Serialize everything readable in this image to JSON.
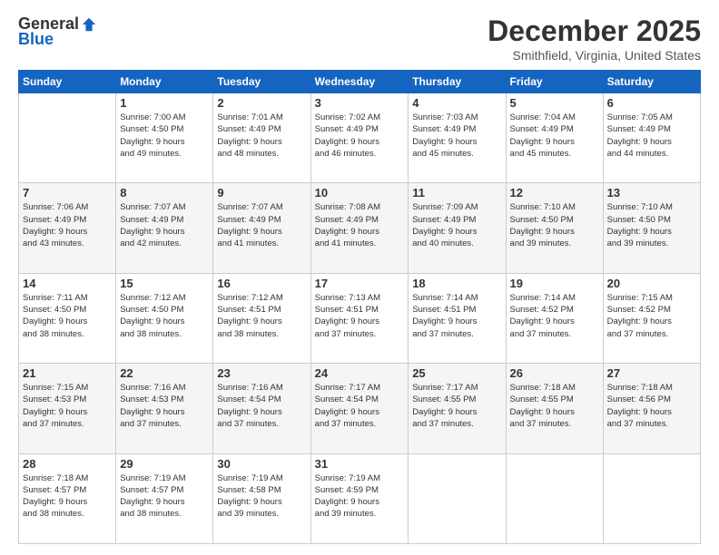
{
  "logo": {
    "general": "General",
    "blue": "Blue"
  },
  "header": {
    "title": "December 2025",
    "location": "Smithfield, Virginia, United States"
  },
  "weekdays": [
    "Sunday",
    "Monday",
    "Tuesday",
    "Wednesday",
    "Thursday",
    "Friday",
    "Saturday"
  ],
  "weeks": [
    [
      {
        "day": "",
        "info": ""
      },
      {
        "day": "1",
        "info": "Sunrise: 7:00 AM\nSunset: 4:50 PM\nDaylight: 9 hours\nand 49 minutes."
      },
      {
        "day": "2",
        "info": "Sunrise: 7:01 AM\nSunset: 4:49 PM\nDaylight: 9 hours\nand 48 minutes."
      },
      {
        "day": "3",
        "info": "Sunrise: 7:02 AM\nSunset: 4:49 PM\nDaylight: 9 hours\nand 46 minutes."
      },
      {
        "day": "4",
        "info": "Sunrise: 7:03 AM\nSunset: 4:49 PM\nDaylight: 9 hours\nand 45 minutes."
      },
      {
        "day": "5",
        "info": "Sunrise: 7:04 AM\nSunset: 4:49 PM\nDaylight: 9 hours\nand 45 minutes."
      },
      {
        "day": "6",
        "info": "Sunrise: 7:05 AM\nSunset: 4:49 PM\nDaylight: 9 hours\nand 44 minutes."
      }
    ],
    [
      {
        "day": "7",
        "info": "Sunrise: 7:06 AM\nSunset: 4:49 PM\nDaylight: 9 hours\nand 43 minutes."
      },
      {
        "day": "8",
        "info": "Sunrise: 7:07 AM\nSunset: 4:49 PM\nDaylight: 9 hours\nand 42 minutes."
      },
      {
        "day": "9",
        "info": "Sunrise: 7:07 AM\nSunset: 4:49 PM\nDaylight: 9 hours\nand 41 minutes."
      },
      {
        "day": "10",
        "info": "Sunrise: 7:08 AM\nSunset: 4:49 PM\nDaylight: 9 hours\nand 41 minutes."
      },
      {
        "day": "11",
        "info": "Sunrise: 7:09 AM\nSunset: 4:49 PM\nDaylight: 9 hours\nand 40 minutes."
      },
      {
        "day": "12",
        "info": "Sunrise: 7:10 AM\nSunset: 4:50 PM\nDaylight: 9 hours\nand 39 minutes."
      },
      {
        "day": "13",
        "info": "Sunrise: 7:10 AM\nSunset: 4:50 PM\nDaylight: 9 hours\nand 39 minutes."
      }
    ],
    [
      {
        "day": "14",
        "info": "Sunrise: 7:11 AM\nSunset: 4:50 PM\nDaylight: 9 hours\nand 38 minutes."
      },
      {
        "day": "15",
        "info": "Sunrise: 7:12 AM\nSunset: 4:50 PM\nDaylight: 9 hours\nand 38 minutes."
      },
      {
        "day": "16",
        "info": "Sunrise: 7:12 AM\nSunset: 4:51 PM\nDaylight: 9 hours\nand 38 minutes."
      },
      {
        "day": "17",
        "info": "Sunrise: 7:13 AM\nSunset: 4:51 PM\nDaylight: 9 hours\nand 37 minutes."
      },
      {
        "day": "18",
        "info": "Sunrise: 7:14 AM\nSunset: 4:51 PM\nDaylight: 9 hours\nand 37 minutes."
      },
      {
        "day": "19",
        "info": "Sunrise: 7:14 AM\nSunset: 4:52 PM\nDaylight: 9 hours\nand 37 minutes."
      },
      {
        "day": "20",
        "info": "Sunrise: 7:15 AM\nSunset: 4:52 PM\nDaylight: 9 hours\nand 37 minutes."
      }
    ],
    [
      {
        "day": "21",
        "info": "Sunrise: 7:15 AM\nSunset: 4:53 PM\nDaylight: 9 hours\nand 37 minutes."
      },
      {
        "day": "22",
        "info": "Sunrise: 7:16 AM\nSunset: 4:53 PM\nDaylight: 9 hours\nand 37 minutes."
      },
      {
        "day": "23",
        "info": "Sunrise: 7:16 AM\nSunset: 4:54 PM\nDaylight: 9 hours\nand 37 minutes."
      },
      {
        "day": "24",
        "info": "Sunrise: 7:17 AM\nSunset: 4:54 PM\nDaylight: 9 hours\nand 37 minutes."
      },
      {
        "day": "25",
        "info": "Sunrise: 7:17 AM\nSunset: 4:55 PM\nDaylight: 9 hours\nand 37 minutes."
      },
      {
        "day": "26",
        "info": "Sunrise: 7:18 AM\nSunset: 4:55 PM\nDaylight: 9 hours\nand 37 minutes."
      },
      {
        "day": "27",
        "info": "Sunrise: 7:18 AM\nSunset: 4:56 PM\nDaylight: 9 hours\nand 37 minutes."
      }
    ],
    [
      {
        "day": "28",
        "info": "Sunrise: 7:18 AM\nSunset: 4:57 PM\nDaylight: 9 hours\nand 38 minutes."
      },
      {
        "day": "29",
        "info": "Sunrise: 7:19 AM\nSunset: 4:57 PM\nDaylight: 9 hours\nand 38 minutes."
      },
      {
        "day": "30",
        "info": "Sunrise: 7:19 AM\nSunset: 4:58 PM\nDaylight: 9 hours\nand 39 minutes."
      },
      {
        "day": "31",
        "info": "Sunrise: 7:19 AM\nSunset: 4:59 PM\nDaylight: 9 hours\nand 39 minutes."
      },
      {
        "day": "",
        "info": ""
      },
      {
        "day": "",
        "info": ""
      },
      {
        "day": "",
        "info": ""
      }
    ]
  ]
}
